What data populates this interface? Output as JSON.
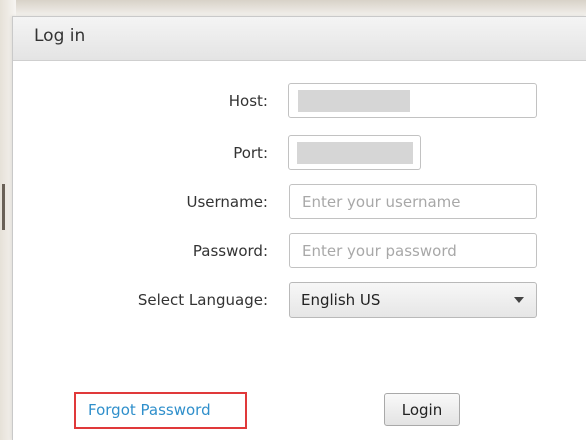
{
  "window": {
    "title": "Log in"
  },
  "form": {
    "host_label": "Host:",
    "host_value": "",
    "port_label": "Port:",
    "port_value": "",
    "username_label": "Username:",
    "username_placeholder": "Enter your username",
    "password_label": "Password:",
    "password_placeholder": "Enter your password",
    "language_label": "Select Language:",
    "language_value": "English US"
  },
  "actions": {
    "forgot_password": "Forgot Password",
    "login": "Login"
  },
  "icons": {
    "language_dropdown": "chevron-down-icon"
  },
  "colors": {
    "link": "#2f8fcb",
    "highlight_box": "#e0393a"
  }
}
